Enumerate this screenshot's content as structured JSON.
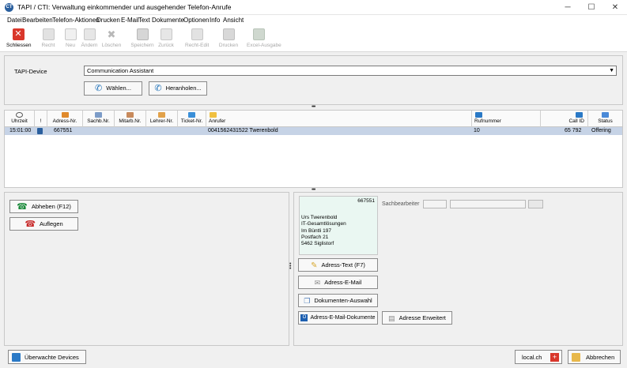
{
  "window": {
    "title": "TAPI / CTI: Verwaltung einkommender und ausgehender Telefon-Anrufe",
    "app_icon_text": "CT",
    "minimize": "─",
    "maximize": "☐",
    "close": "✕"
  },
  "menu": [
    "Datei",
    "Bearbeiten",
    "Telefon-Aktionen",
    "Drucken",
    "E-Mail",
    "Text",
    "Dokumente",
    "Optionen",
    "Info",
    "Ansicht"
  ],
  "toolbar": {
    "close": "Schliessen",
    "recht": "Recht",
    "neu": "Neu",
    "aendern": "Ändern",
    "loeschen": "Löschen",
    "speichern": "Speichern",
    "zurueck": "Zurück",
    "recht_edit": "Recht-Edit",
    "drucken": "Drucken",
    "excel": "Excel-Ausgabe"
  },
  "device": {
    "label": "TAPI-Device",
    "selected": "Communication Assistant",
    "select_button": "Wählen...",
    "fetch_button": "Heranholen..."
  },
  "grid": {
    "columns": [
      "Uhrzeit",
      "!",
      "Adress-Nr.",
      "Sachb.Nr.",
      "Mitarb.Nr.",
      "Lehrer-Nr.",
      "Ticket-Nr.",
      "Anrufer",
      "Rufnummer",
      "Call ID",
      "Status"
    ],
    "row": {
      "time": "15:01:00",
      "address_nr": "667551",
      "caller": "0041562431522 Twerenbold",
      "number": "10",
      "call_id": "65 792",
      "status": "Offering"
    }
  },
  "actions": {
    "answer": "Abheben (F12)",
    "hangup": "Auflegen"
  },
  "address": {
    "number": "667551",
    "lines": [
      "Urs Twerenbold",
      "IT-Gesamtlösungen",
      "Im Büntli 197",
      "Postfach 21",
      "5462 Siglistorf"
    ],
    "sachbearbeiter_label": "Sachbearbeiter"
  },
  "address_buttons": {
    "text": "Adress-Text (F7)",
    "email": "Adress-E-Mail",
    "docs": "Dokumenten-Auswahl",
    "email_docs": "Adress-E-Mail-Dokumente",
    "extended": "Adresse Erweitert"
  },
  "footer": {
    "devices": "Überwachte Devices",
    "local": "local.ch",
    "cancel": "Abbrechen"
  },
  "colors": {
    "selected_row": "#c6d3e6",
    "address_card": "#eaf7f2",
    "close_red": "#d9372b"
  }
}
